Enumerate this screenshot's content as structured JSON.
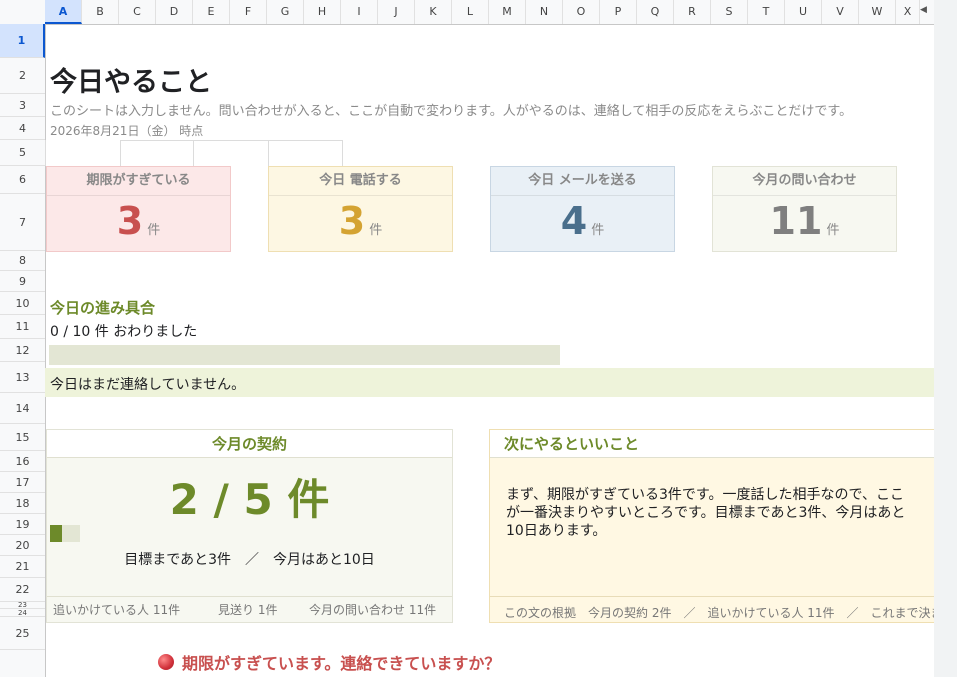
{
  "columns": [
    "A",
    "B",
    "C",
    "D",
    "E",
    "F",
    "G",
    "H",
    "I",
    "J",
    "K",
    "L",
    "M",
    "N",
    "O",
    "P",
    "Q",
    "R",
    "S",
    "T",
    "U",
    "V",
    "W",
    "X"
  ],
  "rows": [
    "1",
    "2",
    "3",
    "4",
    "5",
    "6",
    "7",
    "8",
    "9",
    "10",
    "11",
    "12",
    "13",
    "14",
    "15",
    "16",
    "17",
    "18",
    "19",
    "20",
    "21",
    "22",
    "23",
    "24",
    "25"
  ],
  "header": {
    "title": "今日やること",
    "subtitle": "このシートは入力しません。問い合わせが入ると、ここが自動で変わります。人がやるのは、連絡して相手の反応をえらぶことだけです。",
    "date": "2026年8月21日（金） 時点"
  },
  "cards": [
    {
      "label": "期限がすぎている",
      "value": "3",
      "unit": "件",
      "color": "#c8504f",
      "bg": "#fce8e8",
      "border": "#f2c9c9"
    },
    {
      "label": "今日 電話する",
      "value": "3",
      "unit": "件",
      "color": "#d4a332",
      "bg": "#fdf7e3",
      "border": "#efdfb2"
    },
    {
      "label": "今日 メールを送る",
      "value": "4",
      "unit": "件",
      "color": "#4a6f8c",
      "bg": "#e9f0f6",
      "border": "#c8d6e3"
    },
    {
      "label": "今月の問い合わせ",
      "value": "11",
      "unit": "件",
      "color": "#7f7f7f",
      "bg": "#f7f8f1",
      "border": "#e2e3d6"
    }
  ],
  "progress": {
    "title": "今日の進み具合",
    "summary": "0 / 10 件 おわりました",
    "fraction": 0,
    "message": "今日はまだ連絡していません。"
  },
  "contract": {
    "title": "今月の契約",
    "value": "2 / 5 件",
    "fraction": 0.4,
    "remaining": "目標まであと3件　／　今月はあと10日",
    "footer": [
      "追いかけている人 11件",
      "見送り 1件",
      "今月の問い合わせ 11件"
    ]
  },
  "next": {
    "title": "次にやるといいこと",
    "body": "まず、期限がすぎている3件です。一度話した相手なので、ここが一番決まりやすいところです。目標まであと3件、今月はあと10日あります。",
    "footer": "この文の根拠　今月の契約 2件　／　追いかけている人 11件　／　これまで決ま"
  },
  "warning": {
    "text": "期限がすぎています。連絡できていますか？"
  },
  "colors": {
    "accent": "#6d8a2a",
    "selected": "#0b57d0"
  }
}
